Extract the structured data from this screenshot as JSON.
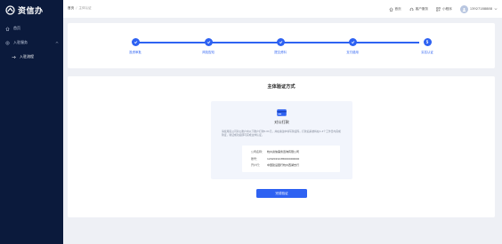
{
  "app": {
    "name": "资信办"
  },
  "sidebar": {
    "items": [
      {
        "label": "首页",
        "icon": "home-icon"
      },
      {
        "label": "入驻服务",
        "icon": "service-icon"
      },
      {
        "label": "入驻流程",
        "icon": "flow-icon"
      }
    ]
  },
  "topbar": {
    "breadcrumb": {
      "home": "首页",
      "current": "主体认证"
    },
    "actions": [
      {
        "label": "首页",
        "icon": "home-icon"
      },
      {
        "label": "客户服务",
        "icon": "headset-icon"
      },
      {
        "label": "小程序",
        "icon": "qrcode-icon"
      }
    ],
    "user": {
      "name": "13927188888"
    }
  },
  "steps": [
    {
      "label": "投资审批",
      "state": "done"
    },
    {
      "label": "风险告知",
      "state": "done"
    },
    {
      "label": "提交资料",
      "state": "done"
    },
    {
      "label": "支付费用",
      "state": "done"
    },
    {
      "label": "实名认证",
      "state": "current",
      "number": "5"
    }
  ],
  "main": {
    "title": "主体验证方式",
    "payment": {
      "title": "对公打款",
      "desc": "请使用贵公司对公账户向以下账户打款0.01元，并在备注中填写验证码，打款后系统将在1-2个工作日内完成验证，验证成功后即可完成主体认证。",
      "rows": [
        {
          "key": "公司名称：",
          "value": "杭州资信事务咨询有限公司"
        },
        {
          "key": "账号：",
          "value": "1202019138000000000"
        },
        {
          "key": "开户行：",
          "value": "中国建设银行杭州西湖支行"
        }
      ]
    },
    "submit_label": "完成验证"
  },
  "colors": {
    "accent": "#2e62f2",
    "sidebar": "#0b1a3c",
    "background": "#eef0f5"
  }
}
